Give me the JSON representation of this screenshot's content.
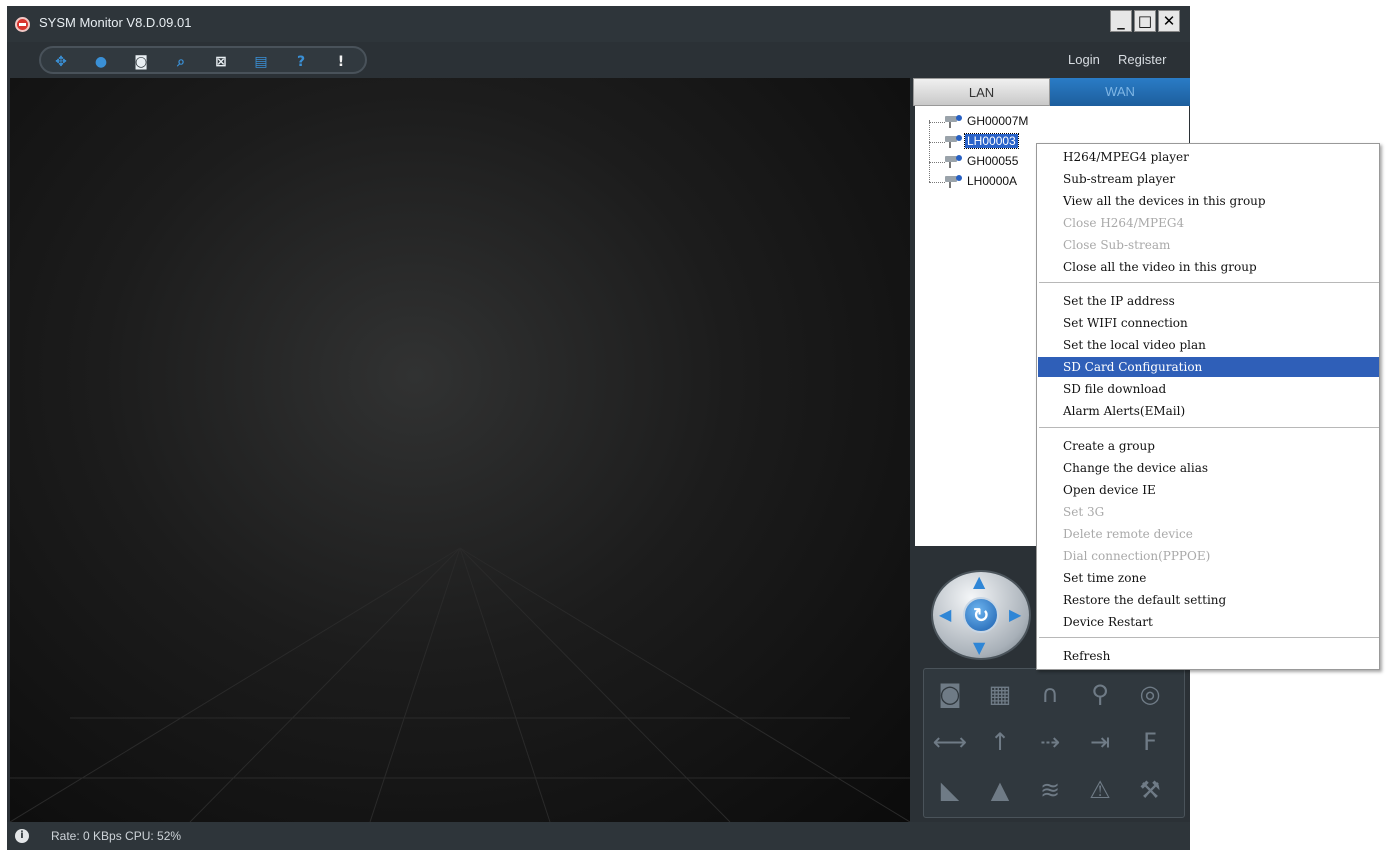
{
  "window": {
    "title": "SYSM Monitor  V8.D.09.01",
    "minimize_label": "_",
    "maximize_label": "□",
    "close_label": "✕"
  },
  "header": {
    "login_label": "Login",
    "register_label": "Register"
  },
  "toolbar": {
    "icons": [
      "layout-icon",
      "record-icon",
      "snapshot-icon",
      "search-icon",
      "lock-icon",
      "save-icon",
      "help-icon",
      "about-icon"
    ]
  },
  "tabs": {
    "lan_label": "LAN",
    "wan_label": "WAN"
  },
  "devices": [
    {
      "name": "GH00007M",
      "selected": false
    },
    {
      "name": "LH00003",
      "selected": true
    },
    {
      "name": "GH00055",
      "selected": false
    },
    {
      "name": "LH0000A",
      "selected": false
    }
  ],
  "context_menu": {
    "items": [
      {
        "label": "H264/MPEG4 player",
        "enabled": true
      },
      {
        "label": "Sub-stream player",
        "enabled": true
      },
      {
        "label": "View all the devices in this group",
        "enabled": true
      },
      {
        "label": "Close H264/MPEG4",
        "enabled": false
      },
      {
        "label": "Close Sub-stream",
        "enabled": false
      },
      {
        "label": "Close all the video in this group",
        "enabled": true
      },
      {
        "label": "Set the IP address",
        "enabled": true
      },
      {
        "label": "Set WIFI connection",
        "enabled": true
      },
      {
        "label": "Set the local video plan",
        "enabled": true
      },
      {
        "label": "SD Card Configuration",
        "enabled": true,
        "highlighted": true
      },
      {
        "label": "SD file download",
        "enabled": true
      },
      {
        "label": "Alarm Alerts(EMail)",
        "enabled": true
      },
      {
        "label": "Create a group",
        "enabled": true
      },
      {
        "label": "Change the device alias",
        "enabled": true
      },
      {
        "label": "Open device IE",
        "enabled": true
      },
      {
        "label": "Set 3G",
        "enabled": false
      },
      {
        "label": "Delete remote device",
        "enabled": false
      },
      {
        "label": "Dial connection(PPPOE)",
        "enabled": false
      },
      {
        "label": "Set time zone",
        "enabled": true
      },
      {
        "label": "Restore the default setting",
        "enabled": true
      },
      {
        "label": "Device Restart",
        "enabled": true
      },
      {
        "label": "Refresh",
        "enabled": true
      }
    ]
  },
  "controls": {
    "ptz_icons": [
      "ptz-up-icon",
      "ptz-down-icon",
      "ptz-left-icon",
      "ptz-right-icon",
      "ptz-refresh-icon"
    ],
    "panel_icons": [
      "snapshot-icon",
      "record-icon",
      "headphones-icon",
      "microphone-icon",
      "disc-icon",
      "arrow-left-right-icon",
      "arrow-up-icon",
      "arrow-right-icon",
      "enter-icon",
      "flag-icon",
      "horizontal-patrol-icon",
      "vertical-patrol-icon",
      "wifi-icon",
      "alarm-icon",
      "settings-wrench-icon"
    ]
  },
  "status": {
    "text": "Rate: 0 KBps  CPU: 52%"
  },
  "colors": {
    "accent": "#2a63c9",
    "menu_highlight": "#2f5fb8",
    "window_bg": "#2b3136"
  }
}
